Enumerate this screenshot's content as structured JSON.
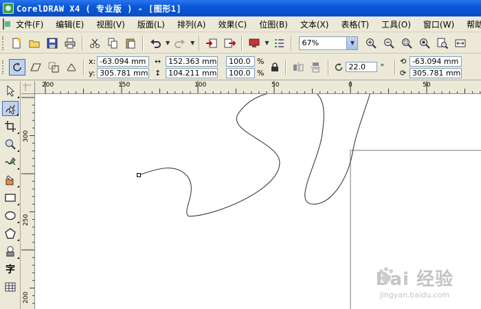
{
  "window": {
    "title": "CorelDRAW X4 ( 专业版 ) - [图形1]"
  },
  "menu": [
    {
      "label": "文件(F)"
    },
    {
      "label": "编辑(E)"
    },
    {
      "label": "视图(V)"
    },
    {
      "label": "版面(L)"
    },
    {
      "label": "排列(A)"
    },
    {
      "label": "效果(C)"
    },
    {
      "label": "位图(B)"
    },
    {
      "label": "文本(X)"
    },
    {
      "label": "表格(T)"
    },
    {
      "label": "工具(O)"
    },
    {
      "label": "窗口(W)"
    },
    {
      "label": "帮助"
    }
  ],
  "standard_toolbar": {
    "zoom": "67%"
  },
  "property_bar": {
    "x_label": "x:",
    "y_label": "y:",
    "x": "-63.094 mm",
    "y": "305.781 mm",
    "width": "152.363 mm",
    "height": "104.211 mm",
    "scale_w": "100.0",
    "scale_h": "100.0",
    "percent": "%",
    "rotation": "22.0",
    "degree": "°",
    "center_x": "-63.094 mm",
    "center_y": "305.781 mm"
  },
  "ruler_h": {
    "labels": [
      "200",
      "150",
      "100",
      "50",
      "0",
      "50"
    ]
  },
  "ruler_v": {
    "labels": [
      "300",
      "250",
      "200"
    ]
  },
  "toolbox": {
    "text_tool": "字"
  },
  "watermark": {
    "brand": "Bai 经验",
    "url": "jingyan.baidu.com"
  },
  "colors": {
    "titlebar": "#0a58d8",
    "chrome": "#ece9d8",
    "canvas": "#ffffff",
    "accent": "#316ac5"
  }
}
